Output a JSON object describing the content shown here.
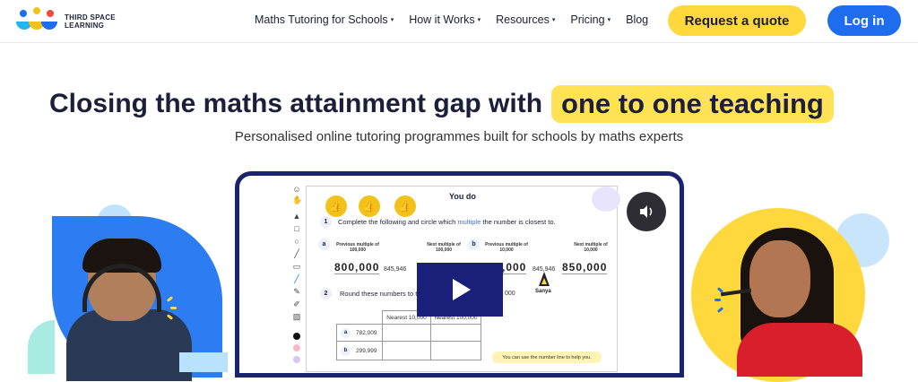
{
  "brand": {
    "name_line1": "THIRD SPACE",
    "name_line2": "LEARNING",
    "colors": {
      "yellow": "#ffd83d",
      "blue": "#1d6dee",
      "navy": "#1c1f3a",
      "video_border": "#1a236e"
    }
  },
  "nav": {
    "items": [
      {
        "label": "Maths Tutoring for Schools",
        "has_caret": true
      },
      {
        "label": "How it Works",
        "has_caret": true
      },
      {
        "label": "Resources",
        "has_caret": true
      },
      {
        "label": "Pricing",
        "has_caret": true
      },
      {
        "label": "Blog",
        "has_caret": false
      }
    ],
    "caret": "▾",
    "cta_quote": "Request a quote",
    "cta_login": "Log in"
  },
  "hero": {
    "title_plain": "Closing the maths attainment gap with",
    "title_highlight": "one to one teaching",
    "subtitle": "Personalised online tutoring programmes built for schools by maths experts"
  },
  "video": {
    "worksheet_title": "You do",
    "q1_number": "1",
    "q1_text_before": "Complete the following and circle which",
    "q1_text_highlight": "multiple",
    "q1_text_after": "the number is closest to.",
    "part_a": "a",
    "part_b": "b",
    "prev_multiple_100k": "Previous multiple of 100,000",
    "next_multiple_100k": "Next multiple of 100,000",
    "prev_multiple_10k": "Previous multiple of 10,000",
    "next_multiple_10k": "Next multiple of 10,000",
    "a_prev_value": "800,000",
    "a_number": "845,946",
    "b_prev_value": ",000",
    "b_number": "845,946",
    "b_next_value": "850,000",
    "cursor_name": "Sanya",
    "q2_number": "2",
    "q2_text": "Round these numbers to t",
    "q2_trailing": "000",
    "table_headers": [
      "Nearest 10,000",
      "Nearest 100,000"
    ],
    "table_rows": [
      {
        "label": "a",
        "value": "782,009"
      },
      {
        "label": "b",
        "value": "299,999"
      }
    ],
    "hint": "You can use the number line to help you.",
    "play_icon": "play-icon",
    "sound_icon": "speaker-icon"
  }
}
